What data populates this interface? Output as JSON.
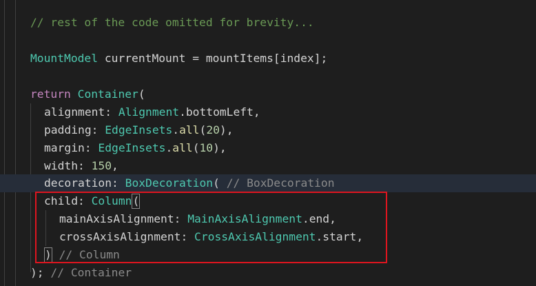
{
  "editor": {
    "lines": [
      {
        "tokens": [
          {
            "cls": "cm",
            "text": "// rest of the code omitted for brevity..."
          }
        ]
      },
      {
        "tokens": []
      },
      {
        "tokens": [
          {
            "cls": "ty",
            "text": "MountModel"
          },
          {
            "cls": "id",
            "text": " currentMount = mountItems[index];"
          }
        ]
      },
      {
        "tokens": []
      },
      {
        "tokens": [
          {
            "cls": "kw",
            "text": "return"
          },
          {
            "cls": "id",
            "text": " "
          },
          {
            "cls": "ty",
            "text": "Container"
          },
          {
            "cls": "id",
            "text": "("
          }
        ]
      },
      {
        "tokens": [
          {
            "cls": "pr",
            "text": "alignment: "
          },
          {
            "cls": "ty",
            "text": "Alignment"
          },
          {
            "cls": "id",
            "text": ".bottomLeft,"
          }
        ]
      },
      {
        "tokens": [
          {
            "cls": "pr",
            "text": "padding: "
          },
          {
            "cls": "ty",
            "text": "EdgeInsets"
          },
          {
            "cls": "id",
            "text": "."
          },
          {
            "cls": "fn",
            "text": "all"
          },
          {
            "cls": "id",
            "text": "("
          },
          {
            "cls": "nm",
            "text": "20"
          },
          {
            "cls": "id",
            "text": "),"
          }
        ]
      },
      {
        "tokens": [
          {
            "cls": "pr",
            "text": "margin: "
          },
          {
            "cls": "ty",
            "text": "EdgeInsets"
          },
          {
            "cls": "id",
            "text": "."
          },
          {
            "cls": "fn",
            "text": "all"
          },
          {
            "cls": "id",
            "text": "("
          },
          {
            "cls": "nm",
            "text": "10"
          },
          {
            "cls": "id",
            "text": "),"
          }
        ]
      },
      {
        "tokens": [
          {
            "cls": "pr",
            "text": "width: "
          },
          {
            "cls": "nm",
            "text": "150"
          },
          {
            "cls": "id",
            "text": ","
          }
        ]
      },
      {
        "tokens": [
          {
            "cls": "pr",
            "text": "decoration: "
          },
          {
            "cls": "ty",
            "text": "BoxDecoration"
          },
          {
            "cls": "id",
            "text": "( "
          },
          {
            "cls": "hint",
            "text": "// BoxDecoration"
          }
        ]
      },
      {
        "tokens": [
          {
            "cls": "pr",
            "text": "child: "
          },
          {
            "cls": "ty",
            "text": "Column"
          },
          {
            "cls": "cursor",
            "text": "("
          }
        ]
      },
      {
        "tokens": [
          {
            "cls": "pr",
            "text": "mainAxisAlignment: "
          },
          {
            "cls": "ty",
            "text": "MainAxisAlignment"
          },
          {
            "cls": "id",
            "text": ".end,"
          }
        ]
      },
      {
        "tokens": [
          {
            "cls": "pr",
            "text": "crossAxisAlignment: "
          },
          {
            "cls": "ty",
            "text": "CrossAxisAlignment"
          },
          {
            "cls": "id",
            "text": ".start,"
          }
        ]
      },
      {
        "tokens": [
          {
            "cls": "cursor",
            "text": ")"
          },
          {
            "cls": "id",
            "text": " "
          },
          {
            "cls": "hint",
            "text": "// Column"
          }
        ]
      },
      {
        "tokens": [
          {
            "cls": "id",
            "text": "); "
          },
          {
            "cls": "hint",
            "text": "// Container"
          }
        ]
      }
    ]
  },
  "colors": {
    "background": "#1e1e1e",
    "comment": "#6a9955",
    "type": "#4ec9b0",
    "keyword": "#c586c0",
    "number": "#b5cea8",
    "function": "#dcdcaa",
    "highlight_border": "#e0151f"
  }
}
